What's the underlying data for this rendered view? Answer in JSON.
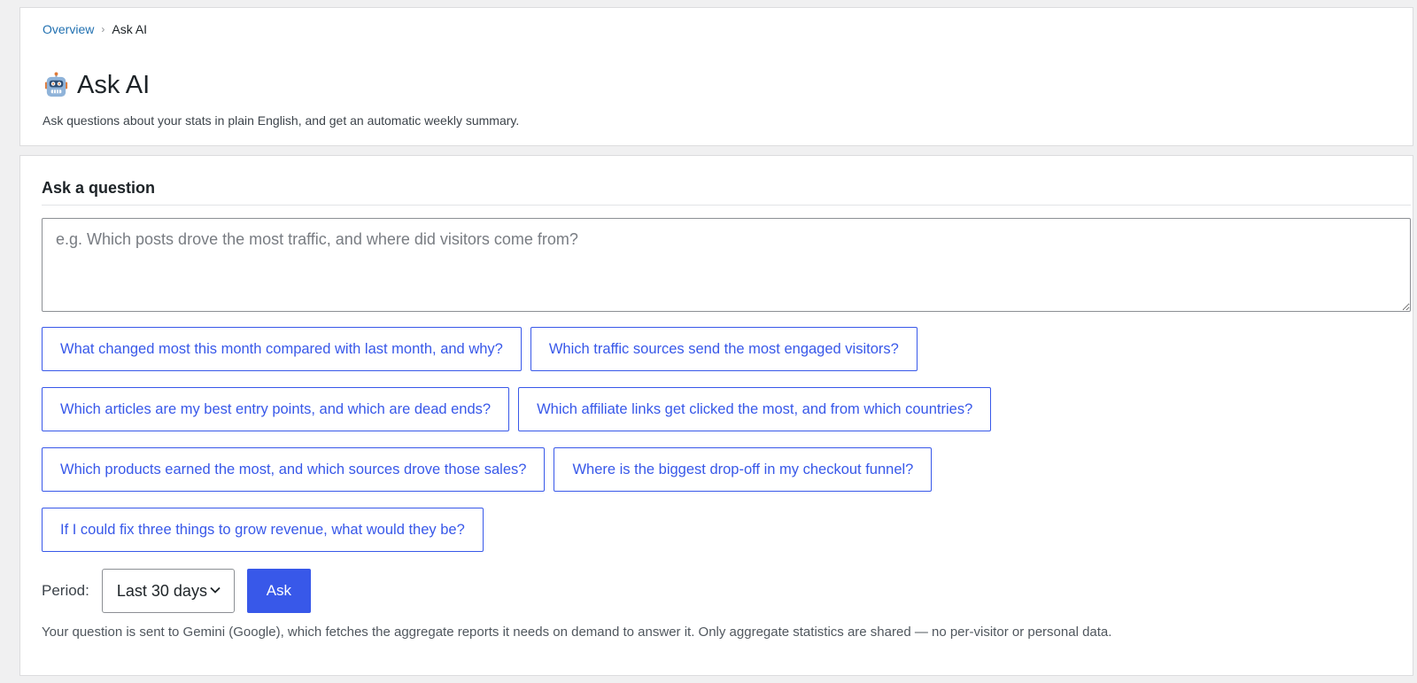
{
  "breadcrumb": {
    "overview_label": "Overview",
    "separator": "›",
    "current_label": "Ask AI"
  },
  "page": {
    "title": "Ask AI",
    "title_icon": "robot-icon",
    "subtitle": "Ask questions about your stats in plain English, and get an automatic weekly summary."
  },
  "ask": {
    "section_title": "Ask a question",
    "question_placeholder": "e.g. Which posts drove the most traffic, and where did visitors come from?",
    "question_value": "",
    "suggestions": [
      [
        "What changed most this month compared with last month, and why?",
        "Which traffic sources send the most engaged visitors?"
      ],
      [
        "Which articles are my best entry points, and which are dead ends?",
        "Which affiliate links get clicked the most, and from which countries?"
      ],
      [
        "Which products earned the most, and which sources drove those sales?",
        "Where is the biggest drop-off in my checkout funnel?"
      ],
      [
        "If I could fix three things to grow revenue, what would they be?"
      ]
    ],
    "period_label": "Period:",
    "period_value": "Last 30 days",
    "ask_button_label": "Ask",
    "disclaimer": "Your question is sent to Gemini (Google), which fetches the aggregate reports it needs on demand to answer it. Only aggregate statistics are shared — no per-visitor or personal data."
  },
  "colors": {
    "accent": "#3858e9",
    "link": "#2271b1",
    "background": "#f0f0f1"
  }
}
